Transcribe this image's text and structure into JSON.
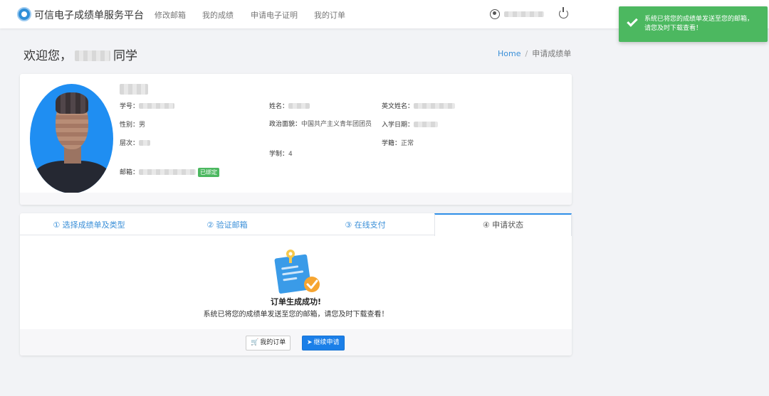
{
  "navbar": {
    "brand": "可信电子成绩单服务平台",
    "links": [
      "修改邮箱",
      "我的成绩",
      "申请电子证明",
      "我的订单"
    ]
  },
  "toast": {
    "message": "系统已将您的成绩单发送至您的邮箱，请您及时下载查看！"
  },
  "welcome": {
    "prefix": "欢迎您，",
    "suffix": "同学"
  },
  "breadcrumb": {
    "home": "Home",
    "sep": "/",
    "current": "申请成绩单"
  },
  "profile": {
    "student_no_label": "学号：",
    "gender_label": "性别：",
    "gender_value": "男",
    "level_label": "层次：",
    "email_label": "邮箱：",
    "email_badge": "已绑定",
    "name_label": "姓名：",
    "political_label": "政治面貌：",
    "political_value": "中国共产主义青年团团员",
    "duration_label": "学制：",
    "duration_value": "4",
    "english_name_label": "英文姓名：",
    "enroll_label": "入学日期：",
    "status_label": "学籍：",
    "status_value": "正常"
  },
  "tabs": [
    "① 选择成绩单及类型",
    "② 验证邮箱",
    "③ 在线支付",
    "④ 申请状态"
  ],
  "result": {
    "title": "订单生成成功!",
    "message": "系统已将您的成绩单发送至您的邮箱，请您及时下载查看！"
  },
  "actions": {
    "my_orders": "我的订单",
    "continue": "继续申请"
  },
  "colors": {
    "primary": "#1b7fe8",
    "success": "#4cb860",
    "link": "#3a8fd8"
  }
}
